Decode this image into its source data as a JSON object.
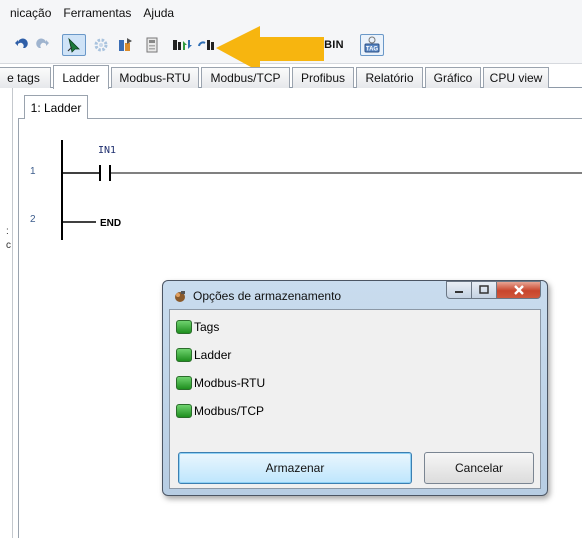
{
  "menu": [
    "nicação",
    "Ferramentas",
    "Ajuda"
  ],
  "toolbar": {
    "bin_label": "BIN",
    "tag_icon_label": "TAG"
  },
  "tabs": [
    "e tags",
    "Ladder",
    "Modbus-RTU",
    "Modbus/TCP",
    "Profibus",
    "Relatório",
    "Gráfico",
    "CPU view"
  ],
  "active_tab": "Ladder",
  "document": {
    "subtab_label": "1: Ladder",
    "rungs": [
      {
        "number": "1",
        "contact_label": "IN1"
      },
      {
        "number": "2",
        "end_label": "END"
      }
    ],
    "side_glyphs": [
      ":",
      "c"
    ]
  },
  "dialog": {
    "title": "Opções de armazenamento",
    "options": [
      "Tags",
      "Ladder",
      "Modbus-RTU",
      "Modbus/TCP"
    ],
    "store_button": "Armazenar",
    "cancel_button": "Cancelar"
  },
  "colors": {
    "callout_arrow": "#f7b50f",
    "checkbox": "#2fa82f",
    "dialog_frame": "#c1d5ea"
  }
}
